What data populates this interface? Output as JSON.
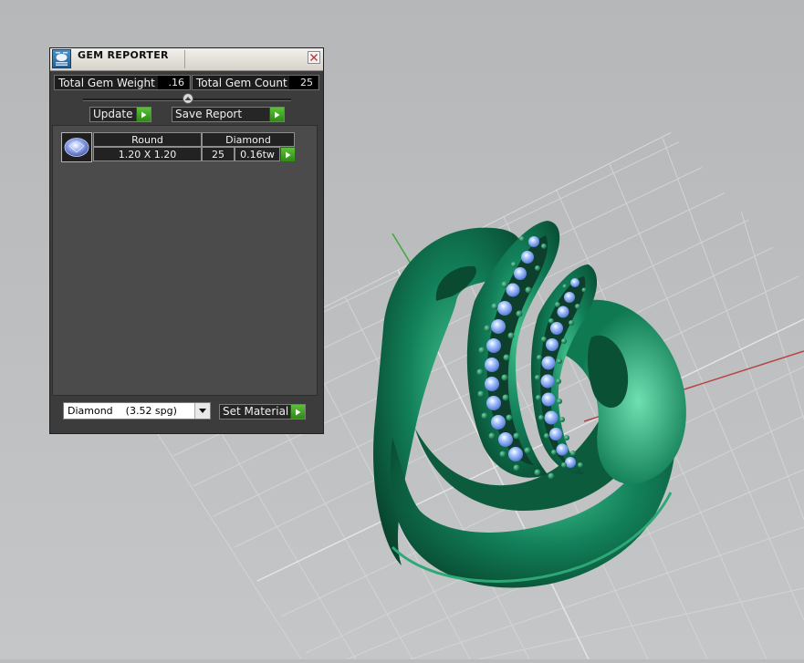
{
  "panel": {
    "title": "GEM REPORTER",
    "total_weight_label": "Total Gem Weight",
    "total_weight_value": ".16",
    "total_count_label": "Total Gem Count",
    "total_count_value": "25",
    "update_label": "Update",
    "save_label": "Save Report"
  },
  "gem_list": [
    {
      "shape": "Round",
      "type": "Diamond",
      "size": "1.20 X 1.20",
      "count": "25",
      "weight": "0.16tw"
    }
  ],
  "material": {
    "selected": "Diamond    (3.52 spg)",
    "set_label": "Set Material"
  },
  "colors": {
    "ring": "#0f6b47",
    "gem": "#8fb8ff",
    "go_button": "#3aa521"
  },
  "icons": [
    "gem-reporter-icon",
    "close-icon",
    "play-icon",
    "dropdown-arrow-icon"
  ]
}
